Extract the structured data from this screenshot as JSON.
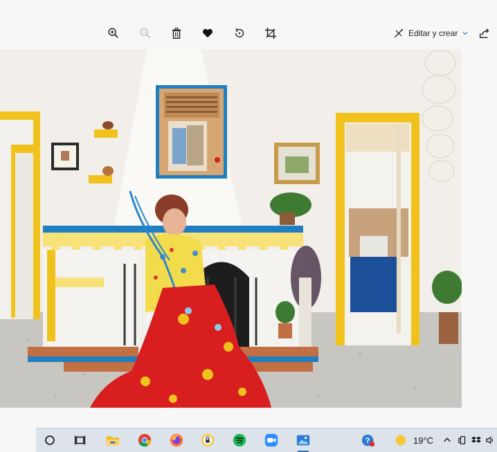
{
  "toolbar": {
    "zoom_in_icon": "zoom-in-icon",
    "zoom_out_icon": "zoom-out-icon",
    "delete_icon": "trash-icon",
    "favorite_icon": "heart-icon",
    "rotate_icon": "rotate-icon",
    "crop_icon": "crop-icon",
    "edit_label": "Editar y crear",
    "share_icon": "share-icon"
  },
  "taskbar": {
    "items": [
      "search-circle-icon",
      "task-view-icon",
      "file-explorer-icon",
      "chrome-icon",
      "firefox-icon",
      "vpn-lock-icon",
      "spotify-icon",
      "zoom-icon",
      "photos-icon",
      "help-icon",
      "weather-sun-icon"
    ],
    "weather_temp": "19°C",
    "tray_icons": [
      "chevron-up-icon",
      "phone-icon",
      "dropbox-icon",
      "speaker-icon"
    ]
  },
  "colors": {
    "accent": "#1a73c9",
    "door_yellow": "#f2c21c",
    "frame_blue": "#1f7fc0",
    "crochet_red": "#d81e1e"
  }
}
